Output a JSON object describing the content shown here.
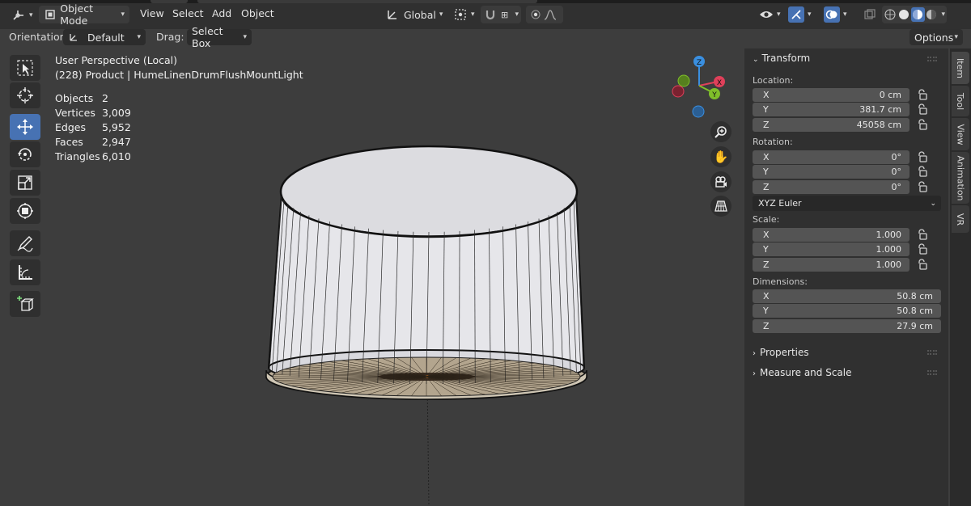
{
  "header": {
    "mode": "Object Mode",
    "menu": [
      "View",
      "Select",
      "Add",
      "Object"
    ],
    "transform_orientation": "Global",
    "options_label": "Options"
  },
  "tool_settings": {
    "orientation_label": "Orientation:",
    "orientation_value": "Default",
    "drag_label": "Drag:",
    "drag_value": "Select Box"
  },
  "viewport": {
    "view_name": "User Perspective (Local)",
    "object_info": "(228) Product | HumeLinenDrumFlushMountLight",
    "stats": [
      {
        "label": "Objects",
        "value": "2"
      },
      {
        "label": "Vertices",
        "value": "3,009"
      },
      {
        "label": "Edges",
        "value": "5,952"
      },
      {
        "label": "Faces",
        "value": "2,947"
      },
      {
        "label": "Triangles",
        "value": "6,010"
      }
    ],
    "gizmo_axes": {
      "x": "X",
      "y": "Y",
      "z": "Z"
    }
  },
  "panel": {
    "transform_title": "Transform",
    "location_label": "Location:",
    "location": [
      {
        "axis": "X",
        "value": "0 cm"
      },
      {
        "axis": "Y",
        "value": "381.7 cm"
      },
      {
        "axis": "Z",
        "value": "45058 cm"
      }
    ],
    "rotation_label": "Rotation:",
    "rotation": [
      {
        "axis": "X",
        "value": "0°"
      },
      {
        "axis": "Y",
        "value": "0°"
      },
      {
        "axis": "Z",
        "value": "0°"
      }
    ],
    "rotation_mode": "XYZ Euler",
    "scale_label": "Scale:",
    "scale": [
      {
        "axis": "X",
        "value": "1.000"
      },
      {
        "axis": "Y",
        "value": "1.000"
      },
      {
        "axis": "Z",
        "value": "1.000"
      }
    ],
    "dimensions_label": "Dimensions:",
    "dimensions": [
      {
        "axis": "X",
        "value": "50.8 cm"
      },
      {
        "axis": "Y",
        "value": "50.8 cm"
      },
      {
        "axis": "Z",
        "value": "27.9 cm"
      }
    ],
    "properties_title": "Properties",
    "measure_title": "Measure and Scale"
  },
  "tabs": [
    "Item",
    "Tool",
    "View",
    "Animation",
    "VR"
  ],
  "colors": {
    "accent": "#4772b3",
    "axis_x": "#e0405a",
    "axis_y": "#7fbf2a",
    "axis_z": "#3a8fe0"
  }
}
